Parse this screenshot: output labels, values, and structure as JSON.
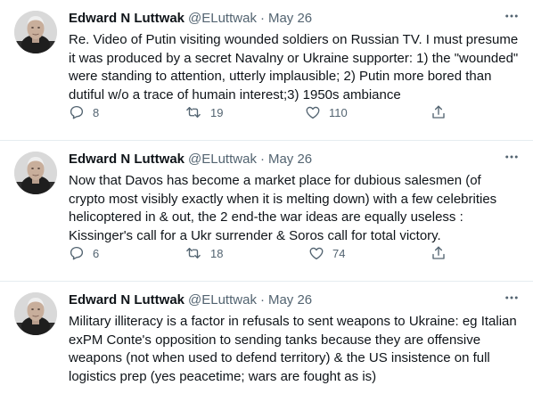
{
  "tweets": [
    {
      "name": "Edward N Luttwak",
      "handle": "@ELuttwak",
      "separator": "·",
      "date": "May 26",
      "text": "Re. Video of Putin visiting wounded soldiers on Russian TV. I must presume it was produced by a secret Navalny or Ukraine supporter: 1) the \"wounded\" were standing to attention, utterly implausible; 2) Putin more bored than dutiful w/o a trace of humain interest;3) 1950s ambiance",
      "replies": "8",
      "retweets": "19",
      "likes": "110"
    },
    {
      "name": "Edward N Luttwak",
      "handle": "@ELuttwak",
      "separator": "·",
      "date": "May 26",
      "text": "Now that Davos has become a market place for dubious salesmen (of crypto most visibly exactly when it is melting down) with a few celebrities helicoptered in & out, the 2 end-the war ideas are equally useless : Kissinger's call for a Ukr surrender & Soros call for total victory.",
      "replies": "6",
      "retweets": "18",
      "likes": "74"
    },
    {
      "name": "Edward N Luttwak",
      "handle": "@ELuttwak",
      "separator": "·",
      "date": "May 26",
      "text": "Military illiteracy is a factor in refusals to sent weapons to Ukraine:  eg Italian exPM Conte's opposition to sending tanks because they are offensive weapons (not when used to defend territory) & the US insistence on full logistics prep (yes peacetime; wars are fought as is)"
    }
  ],
  "icons": {
    "more": "more-horizontal-icon",
    "reply": "reply-icon",
    "retweet": "retweet-icon",
    "like": "heart-icon",
    "share": "share-icon"
  },
  "colors": {
    "text": "#0f1419",
    "secondary": "#536471",
    "border": "#e6ecf0"
  }
}
